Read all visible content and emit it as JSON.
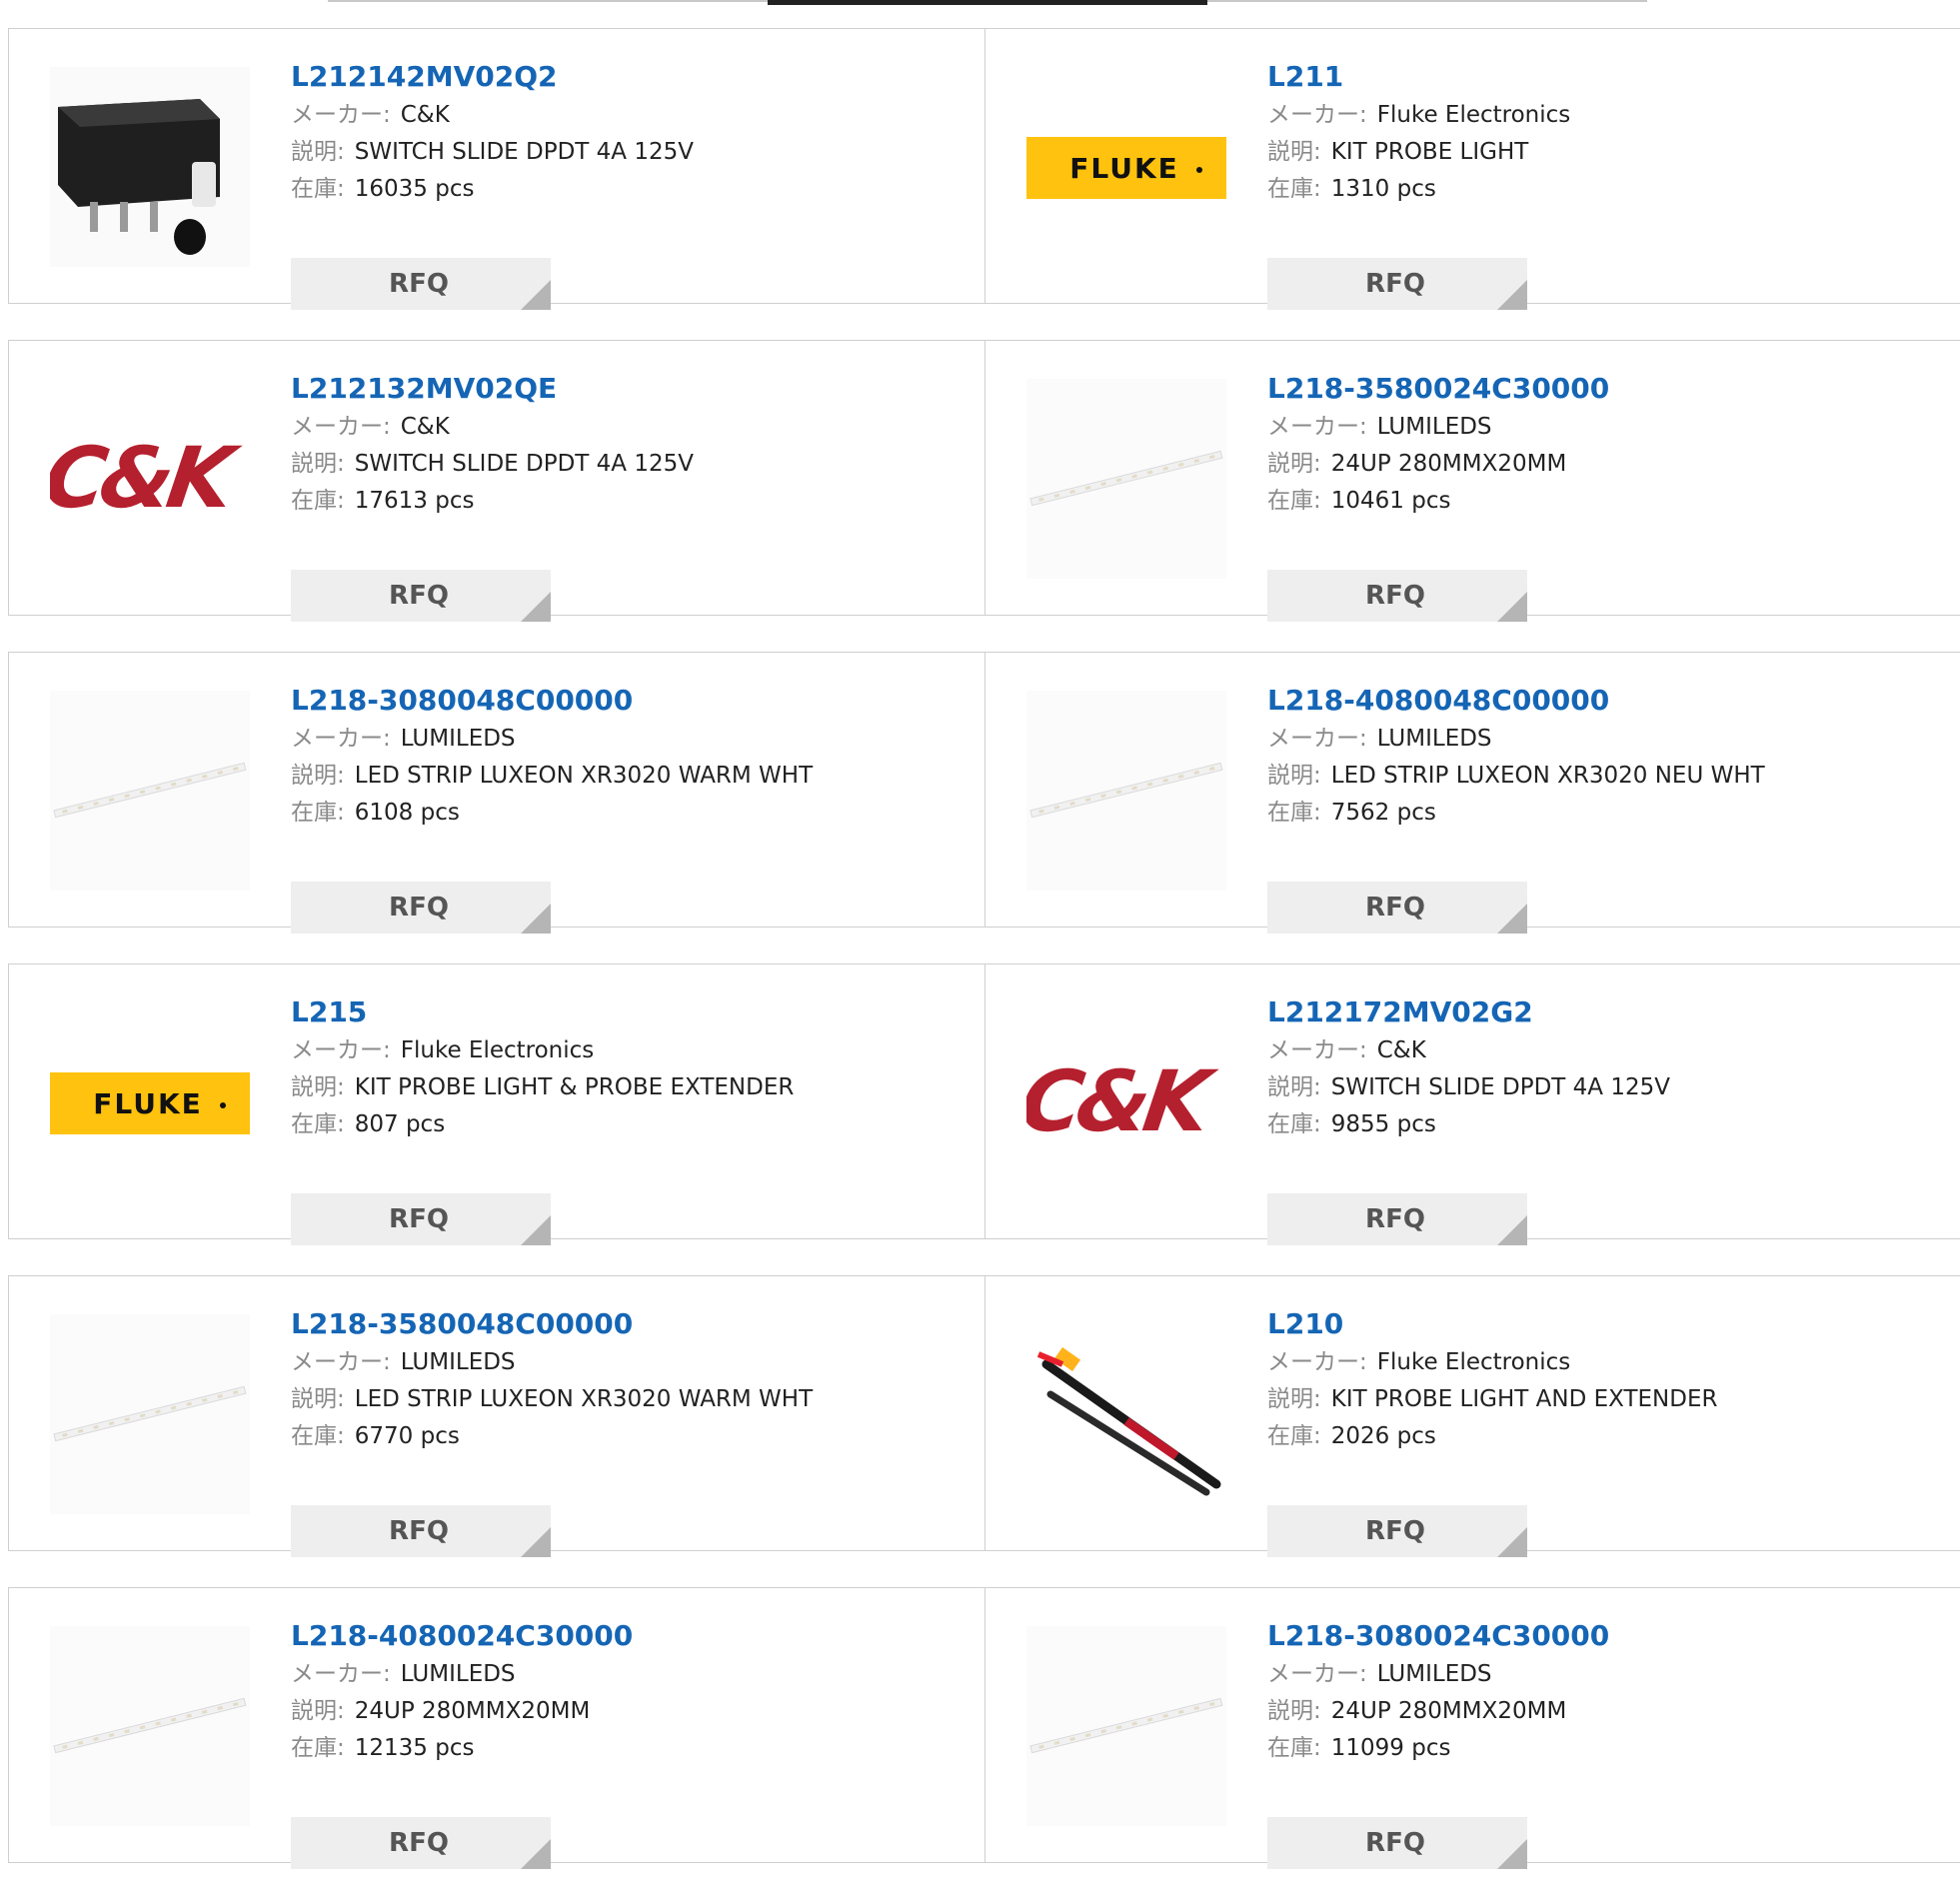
{
  "labels": {
    "maker": "メーカー",
    "desc": "説明",
    "stock": "在庫",
    "sep": ":",
    "rfq": "RFQ"
  },
  "products": [
    {
      "pn": "L212142MV02Q2",
      "maker": "C&K",
      "desc": "SWITCH SLIDE DPDT 4A 125V",
      "stock": "16035 pcs",
      "image": "switch-photo"
    },
    {
      "pn": "L211",
      "maker": "Fluke Electronics",
      "desc": "KIT PROBE LIGHT",
      "stock": "1310 pcs",
      "image": "fluke-logo",
      "logo_text": "FLUKE"
    },
    {
      "pn": "L212132MV02QE",
      "maker": "C&K",
      "desc": "SWITCH SLIDE DPDT 4A 125V",
      "stock": "17613 pcs",
      "image": "ck-logo",
      "logo_text": "C&K"
    },
    {
      "pn": "L218-3580024C30000",
      "maker": "LUMILEDS",
      "desc": "24UP 280MMX20MM",
      "stock": "10461 pcs",
      "image": "led-strip"
    },
    {
      "pn": "L218-3080048C00000",
      "maker": "LUMILEDS",
      "desc": "LED STRIP LUXEON XR3020 WARM WHT",
      "stock": "6108 pcs",
      "image": "led-strip"
    },
    {
      "pn": "L218-4080048C00000",
      "maker": "LUMILEDS",
      "desc": "LED STRIP LUXEON XR3020 NEU WHT",
      "stock": "7562 pcs",
      "image": "led-strip"
    },
    {
      "pn": "L215",
      "maker": "Fluke Electronics",
      "desc": "KIT PROBE LIGHT & PROBE EXTENDER",
      "stock": "807 pcs",
      "image": "fluke-logo",
      "logo_text": "FLUKE"
    },
    {
      "pn": "L212172MV02G2",
      "maker": "C&K",
      "desc": "SWITCH SLIDE DPDT 4A 125V",
      "stock": "9855 pcs",
      "image": "ck-logo",
      "logo_text": "C&K"
    },
    {
      "pn": "L218-3580048C00000",
      "maker": "LUMILEDS",
      "desc": "LED STRIP LUXEON XR3020 WARM WHT",
      "stock": "6770 pcs",
      "image": "led-strip"
    },
    {
      "pn": "L210",
      "maker": "Fluke Electronics",
      "desc": "KIT PROBE LIGHT AND EXTENDER",
      "stock": "2026 pcs",
      "image": "probe-photo"
    },
    {
      "pn": "L218-4080024C30000",
      "maker": "LUMILEDS",
      "desc": "24UP 280MMX20MM",
      "stock": "12135 pcs",
      "image": "led-strip"
    },
    {
      "pn": "L218-3080024C30000",
      "maker": "LUMILEDS",
      "desc": "24UP 280MMX20MM",
      "stock": "11099 pcs",
      "image": "led-strip"
    }
  ],
  "colors": {
    "link": "#1565b5",
    "fluke_yellow": "#ffc20e",
    "ck_red": "#b5202e",
    "button_bg": "#eeeeee"
  }
}
